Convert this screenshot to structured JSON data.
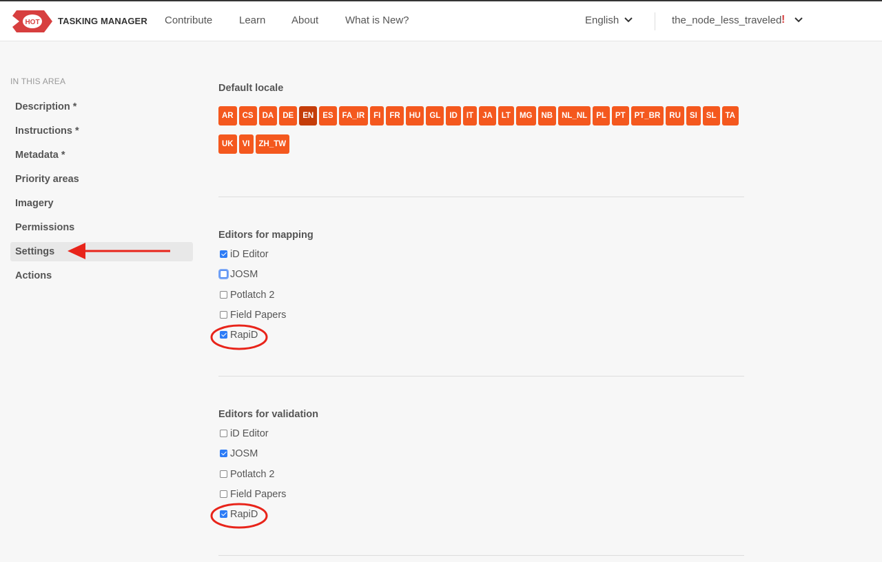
{
  "header": {
    "brand": "TASKING MANAGER",
    "logo_text": "HOT",
    "nav": [
      "Contribute",
      "Learn",
      "About",
      "What is New?"
    ],
    "language": "English",
    "username": "the_node_less_traveled",
    "alert": "!"
  },
  "sidebar": {
    "heading": "IN THIS AREA",
    "items": [
      "Description *",
      "Instructions *",
      "Metadata *",
      "Priority areas",
      "Imagery",
      "Permissions",
      "Settings",
      "Actions"
    ],
    "active": "Settings"
  },
  "locale": {
    "title": "Default locale",
    "options": [
      "AR",
      "CS",
      "DA",
      "DE",
      "EN",
      "ES",
      "FA_IR",
      "FI",
      "FR",
      "HU",
      "GL",
      "ID",
      "IT",
      "JA",
      "LT",
      "MG",
      "NB",
      "NL_NL",
      "PL",
      "PT",
      "PT_BR",
      "RU",
      "SI",
      "SL",
      "TA",
      "UK",
      "VI",
      "ZH_TW"
    ],
    "selected": "EN"
  },
  "mapping_editors": {
    "title": "Editors for mapping",
    "options": [
      {
        "label": "iD Editor",
        "checked": true
      },
      {
        "label": "JOSM",
        "checked": false
      },
      {
        "label": "Potlatch 2",
        "checked": false
      },
      {
        "label": "Field Papers",
        "checked": false
      },
      {
        "label": "RapiD",
        "checked": true
      }
    ]
  },
  "validation_editors": {
    "title": "Editors for validation",
    "options": [
      {
        "label": "iD Editor",
        "checked": false
      },
      {
        "label": "JOSM",
        "checked": true
      },
      {
        "label": "Potlatch 2",
        "checked": false
      },
      {
        "label": "Field Papers",
        "checked": false
      },
      {
        "label": "RapiD",
        "checked": true
      }
    ]
  },
  "colors": {
    "accent": "#f4581e",
    "accent_selected": "#c43d0a",
    "annotation": "#e8241a",
    "checkbox": "#2d7cf6"
  }
}
